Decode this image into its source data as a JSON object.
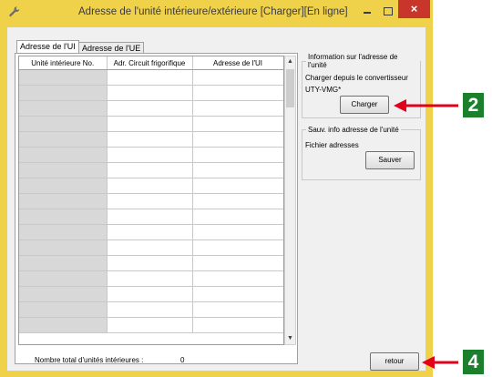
{
  "window": {
    "title": "Adresse de l'unité intérieure/extérieure [Charger][En ligne]",
    "close_glyph": "×",
    "colors": {
      "frame": "#f0d24a",
      "close": "#c8352a",
      "callout": "#1c7f2c",
      "arrow": "#e2001a"
    }
  },
  "tabs": [
    {
      "label": "Adresse de l'UI",
      "active": true
    },
    {
      "label": "Adresse de l'UE",
      "active": false
    }
  ],
  "table": {
    "columns": [
      "Unité intérieure No.",
      "Adr. Circuit frigorifique",
      "Adresse de l'UI"
    ],
    "row_count": 17
  },
  "footer": {
    "total_label": "Nombre total d'unités intérieures :",
    "total_value": "0"
  },
  "info_group": {
    "legend": "Information sur l'adresse de l'unité",
    "line1": "Charger depuis le convertisseur",
    "line2": "UTY-VMG*",
    "load_button": "Charger"
  },
  "save_group": {
    "legend": "Sauv. info adresse de l'unité",
    "file_label": "Fichier adresses",
    "save_button": "Sauver"
  },
  "return_button": "retour",
  "callouts": [
    {
      "label": "2"
    },
    {
      "label": "4"
    }
  ],
  "icons": [
    "wrench-app-icon",
    "minimize-icon",
    "maximize-icon",
    "close-icon",
    "scroll-up-arrow-icon",
    "scroll-down-arrow-icon"
  ]
}
